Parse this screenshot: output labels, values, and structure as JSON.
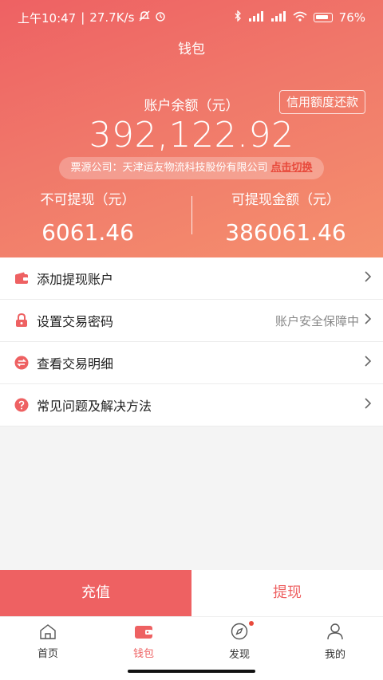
{
  "statusbar": {
    "time": "上午10:47",
    "speed": "27.7K/s",
    "battery": "76%"
  },
  "nav": {
    "title": "钱包"
  },
  "credit_button": "信用额度还款",
  "balance": {
    "label": "账户余额（元）",
    "value": "392,122.92"
  },
  "source": {
    "text": "票源公司：天津运友物流科技股份有限公司",
    "switch": "点击切换"
  },
  "non_withdrawable": {
    "label": "不可提现（元）",
    "value": "6061.46"
  },
  "withdrawable": {
    "label": "可提现金额（元）",
    "value": "386061.46"
  },
  "menu": [
    {
      "label": "添加提现账户",
      "hint": "",
      "icon": "wallet-icon"
    },
    {
      "label": "设置交易密码",
      "hint": "账户安全保障中",
      "icon": "lock-icon"
    },
    {
      "label": "查看交易明细",
      "hint": "",
      "icon": "exchange-icon"
    },
    {
      "label": "常见问题及解决方法",
      "hint": "",
      "icon": "question-icon"
    }
  ],
  "actions": {
    "recharge": "充值",
    "withdraw": "提现"
  },
  "tabs": [
    {
      "label": "首页",
      "icon": "home-icon"
    },
    {
      "label": "钱包",
      "icon": "wallet-icon"
    },
    {
      "label": "发现",
      "icon": "compass-icon"
    },
    {
      "label": "我的",
      "icon": "user-icon"
    }
  ],
  "colors": {
    "accent": "#ee6162",
    "switch": "#e8493b"
  }
}
